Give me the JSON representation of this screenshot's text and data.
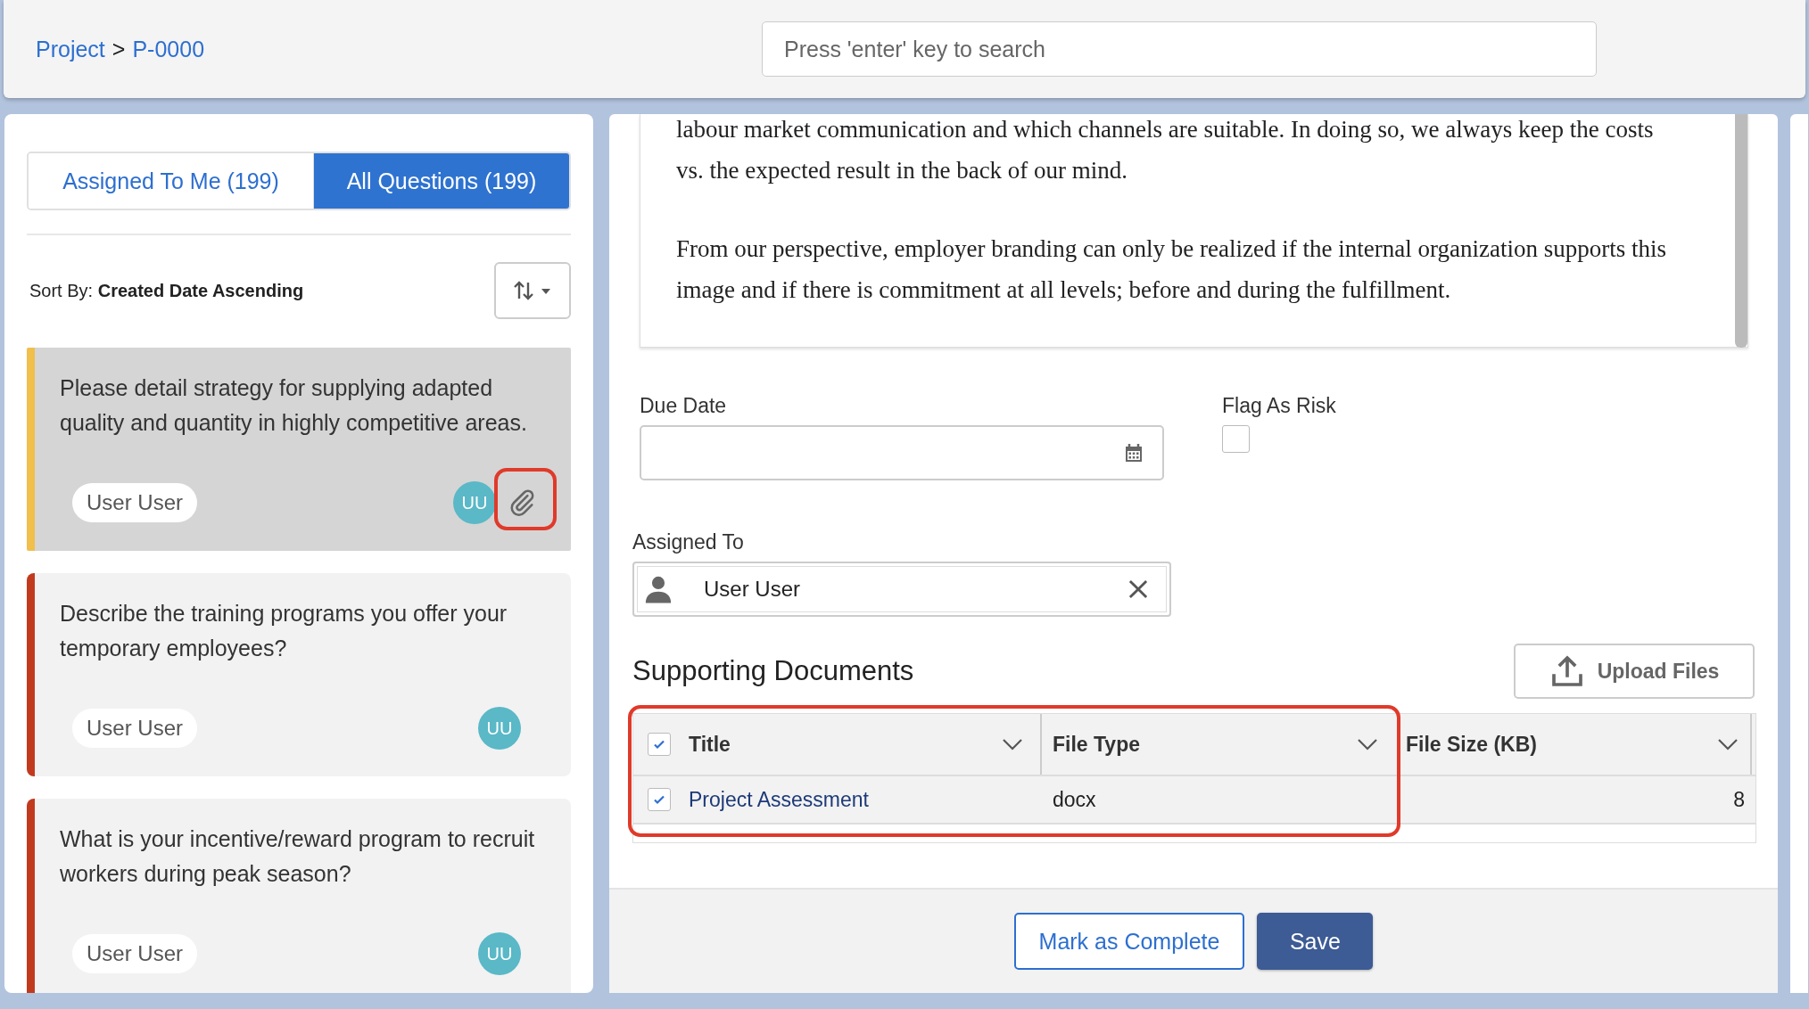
{
  "breadcrumb": {
    "items": [
      "Project",
      "P-0000"
    ],
    "separator": ">"
  },
  "search": {
    "placeholder": "Press 'enter' key to search"
  },
  "tabs": [
    {
      "label": "Assigned To Me (199)",
      "selected": false
    },
    {
      "label": "All Questions (199)",
      "selected": true
    }
  ],
  "sort": {
    "label": "Sort By:",
    "value": "Created Date Ascending"
  },
  "questions": [
    {
      "text": "Please detail strategy for supplying adapted quality and quantity in highly competitive areas.",
      "assignee": "User User",
      "avatar": "UU",
      "color": "#f0bf4c",
      "selected": true,
      "attachment": true
    },
    {
      "text": "Describe the training programs you offer your temporary employees?",
      "assignee": "User User",
      "avatar": "UU",
      "color": "#c23a1e",
      "selected": false,
      "attachment": false
    },
    {
      "text": "What is your incentive/reward program to recruit workers during peak season?",
      "assignee": "User User",
      "avatar": "UU",
      "color": "#c23a1e",
      "selected": false,
      "attachment": false
    }
  ],
  "response": {
    "paragraphs": [
      "labour market communication and which channels are suitable. In doing so, we always keep the costs vs. the expected result in the back of our mind.",
      "From our perspective, employer branding can only be realized if the internal organization supports this image and if there is commitment at all levels; before and during the fulfillment."
    ]
  },
  "due_date": {
    "label": "Due Date"
  },
  "flag_as_risk": {
    "label": "Flag As Risk",
    "checked": false
  },
  "assigned_to": {
    "label": "Assigned To",
    "value": "User User"
  },
  "documents": {
    "title": "Supporting Documents",
    "upload_button": "Upload Files",
    "select_all": true,
    "columns": [
      "Title",
      "File Type",
      "File Size (KB)"
    ],
    "rows": [
      {
        "checked": true,
        "title": "Project Assessment",
        "file_type": "docx",
        "file_size": "8"
      }
    ]
  },
  "footer_buttons": [
    {
      "label": "Mark as Complete",
      "kind": "secondary"
    },
    {
      "label": "Save",
      "kind": "primary"
    }
  ]
}
